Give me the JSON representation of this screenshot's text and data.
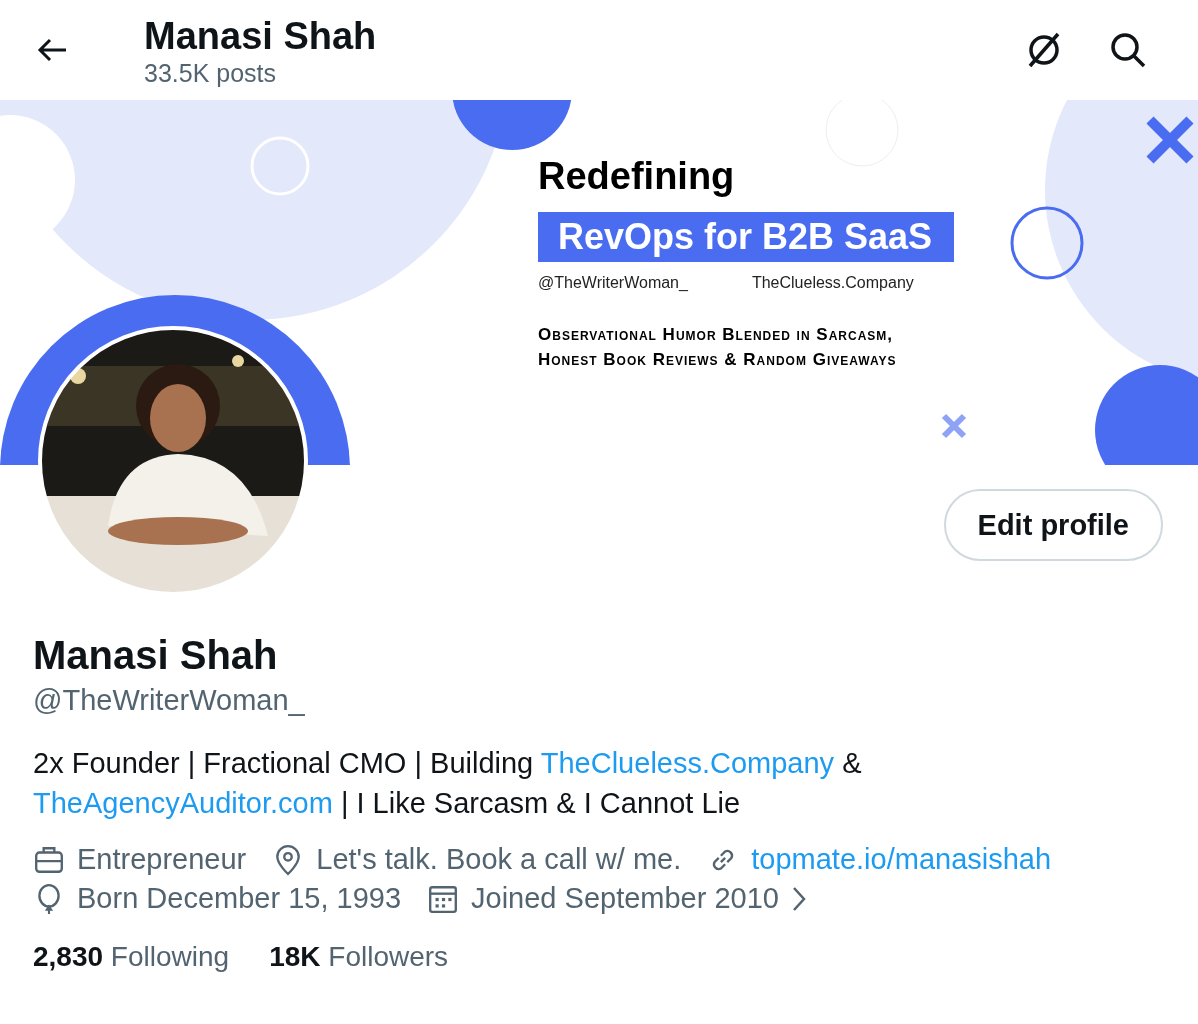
{
  "header": {
    "title": "Manasi Shah",
    "subtitle": "33.5K posts"
  },
  "banner": {
    "kind": "picture",
    "headline": "Redefining",
    "highlight": "RevOps for B2B SaaS",
    "handle": "@TheWriterWoman_",
    "site": "TheClueless.Company",
    "tagline_lines": [
      "Observational Humor Blended in Sarcasm,",
      "Honest Book Reviews & Random Giveaways"
    ]
  },
  "edit_button": "Edit profile",
  "profile": {
    "name": "Manasi Shah",
    "handle": "@TheWriterWoman_",
    "bio": [
      {
        "kind": "text",
        "text": "2x Founder | Fractional CMO | Building "
      },
      {
        "kind": "link",
        "text": "TheClueless.Company"
      },
      {
        "kind": "text",
        "text": " & "
      },
      {
        "kind": "link",
        "text": "TheAgencyAuditor.com"
      },
      {
        "kind": "text",
        "text": " | I Like Sarcasm & I Cannot Lie"
      }
    ],
    "meta": [
      {
        "kind": "profession",
        "text": "Entrepreneur"
      },
      {
        "kind": "location",
        "text": "Let's talk. Book a call w/ me."
      },
      {
        "kind": "website",
        "text": "topmate.io/manasishah"
      },
      {
        "kind": "birthday",
        "text": "Born December 15, 1993"
      },
      {
        "kind": "joined",
        "text": "Joined September 2010"
      }
    ],
    "stats": [
      {
        "count": "2,830",
        "label": "Following"
      },
      {
        "count": "18K",
        "label": "Followers"
      }
    ]
  }
}
